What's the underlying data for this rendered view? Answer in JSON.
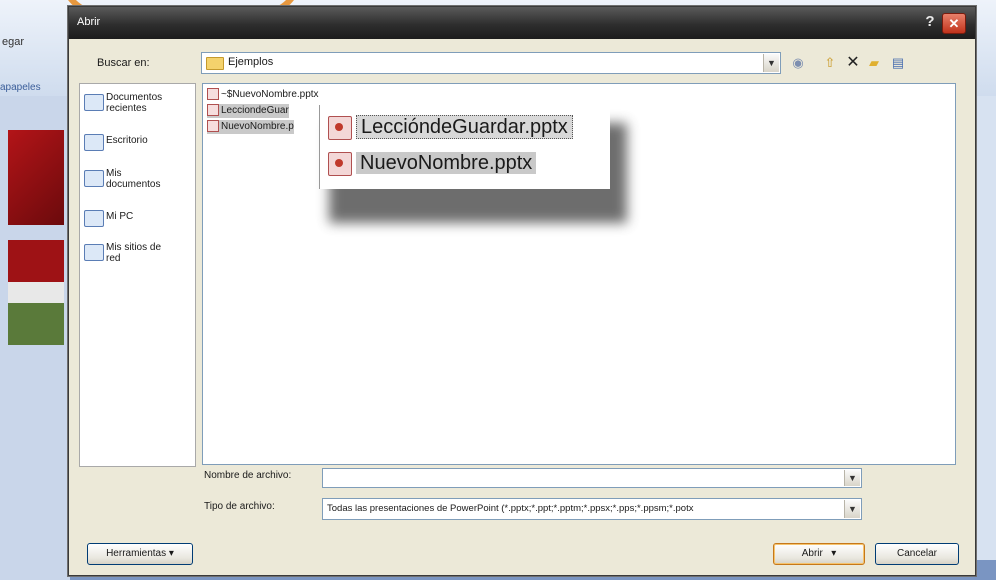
{
  "background": {
    "pegar_label": "egar",
    "portapapeles_label": "apapeles"
  },
  "dialog": {
    "title": "Abrir",
    "help_glyph": "?",
    "close_glyph": "✕"
  },
  "lookin": {
    "label": "Buscar en:",
    "value": "Ejemplos",
    "arrow": "▼"
  },
  "toolbar": {
    "icons": [
      "back-icon",
      "up-folder-icon",
      "delete-icon",
      "new-folder-icon",
      "views-icon"
    ]
  },
  "places": [
    {
      "label": "Documentos recientes",
      "icon": "recent-documents-icon"
    },
    {
      "label": "Escritorio",
      "icon": "desktop-icon"
    },
    {
      "label": "Mis documentos",
      "icon": "my-documents-icon"
    },
    {
      "label": "Mi PC",
      "icon": "my-computer-icon"
    },
    {
      "label": "Mis sitios de red",
      "icon": "network-places-icon"
    }
  ],
  "files": [
    {
      "name": "~$NuevoNombre.pptx"
    },
    {
      "name": "LecciondeGuar"
    },
    {
      "name": "NuevoNombre.p"
    }
  ],
  "callout": {
    "file1": "LeccióndeGuardar.pptx",
    "file2": "NuevoNombre.pptx"
  },
  "filename": {
    "label": "Nombre de archivo:",
    "value": ""
  },
  "filetype": {
    "label": "Tipo de archivo:",
    "value": "Todas las presentaciones de PowerPoint (*.pptx;*.ppt;*.pptm;*.ppsx;*.pps;*.ppsm;*.potx"
  },
  "buttons": {
    "tools": "Herramientas",
    "open": "Abrir",
    "cancel": "Cancelar"
  },
  "colors": {
    "titlebar": "#2e2e2e",
    "close": "#c0331c",
    "dialog_bg": "#ece9d8",
    "selection": "#c9c9c9"
  }
}
